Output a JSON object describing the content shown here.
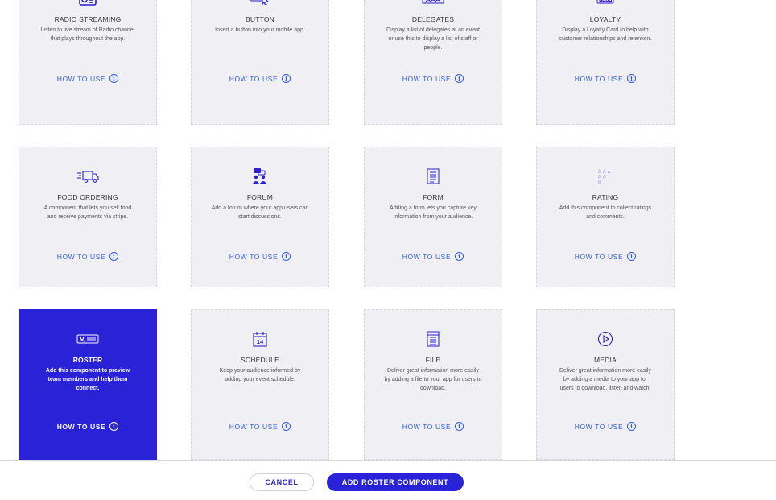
{
  "cards": [
    {
      "icon": "radio-icon",
      "title": "RADIO STREAMING",
      "desc": "Listen to live stream of Radio channel that plays throughout the app.",
      "howto": "HOW TO USE"
    },
    {
      "icon": "button-cursor-icon",
      "title": "BUTTON",
      "desc": "Insert a button into your mobile app.",
      "howto": "HOW TO USE"
    },
    {
      "icon": "delegates-icon",
      "title": "DELEGATES",
      "desc": "Display a list of delegates at an event or use this to display a list of staff or people.",
      "howto": "HOW TO USE"
    },
    {
      "icon": "loyalty-card-icon",
      "title": "LOYALTY",
      "desc": "Display a Loyalty Card to help with customer relationships and retention.",
      "howto": "HOW TO USE"
    },
    {
      "icon": "delivery-truck-icon",
      "title": "FOOD ORDERING",
      "desc": "A component that lets you sell food and receive payments via stripe.",
      "howto": "HOW TO USE"
    },
    {
      "icon": "forum-icon",
      "title": "FORUM",
      "desc": "Add a forum where your app users can start discussions.",
      "howto": "HOW TO USE"
    },
    {
      "icon": "form-icon",
      "title": "FORM",
      "desc": "Adding a form lets you capture key information from your audience.",
      "howto": "HOW TO USE"
    },
    {
      "icon": "rating-stars-icon",
      "title": "RATING",
      "desc": "Add this component to collect ratings and comments.",
      "howto": "HOW TO USE"
    },
    {
      "icon": "id-card-icon",
      "title": "ROSTER",
      "desc": "Add this component to preview team members and help them connect.",
      "howto": "HOW TO USE",
      "selected": true
    },
    {
      "icon": "calendar-icon",
      "title": "SCHEDULE",
      "desc": "Keep your audience informed by adding your event schedule.",
      "howto": "HOW TO USE",
      "calendar_day": "14"
    },
    {
      "icon": "file-icon",
      "title": "FILE",
      "desc": "Deliver great information more easily by adding a file to your app for users to download.",
      "howto": "HOW TO USE"
    },
    {
      "icon": "play-circle-icon",
      "title": "MEDIA",
      "desc": "Deliver great information more easily by adding a media to your app for users to download, listen and watch.",
      "howto": "HOW TO USE"
    }
  ],
  "footer": {
    "cancel_label": "CANCEL",
    "add_label": "ADD ROSTER COMPONENT"
  },
  "colors": {
    "accent": "#2a22d6",
    "card_bg": "#f0eff4",
    "link": "#2f5fd8"
  }
}
